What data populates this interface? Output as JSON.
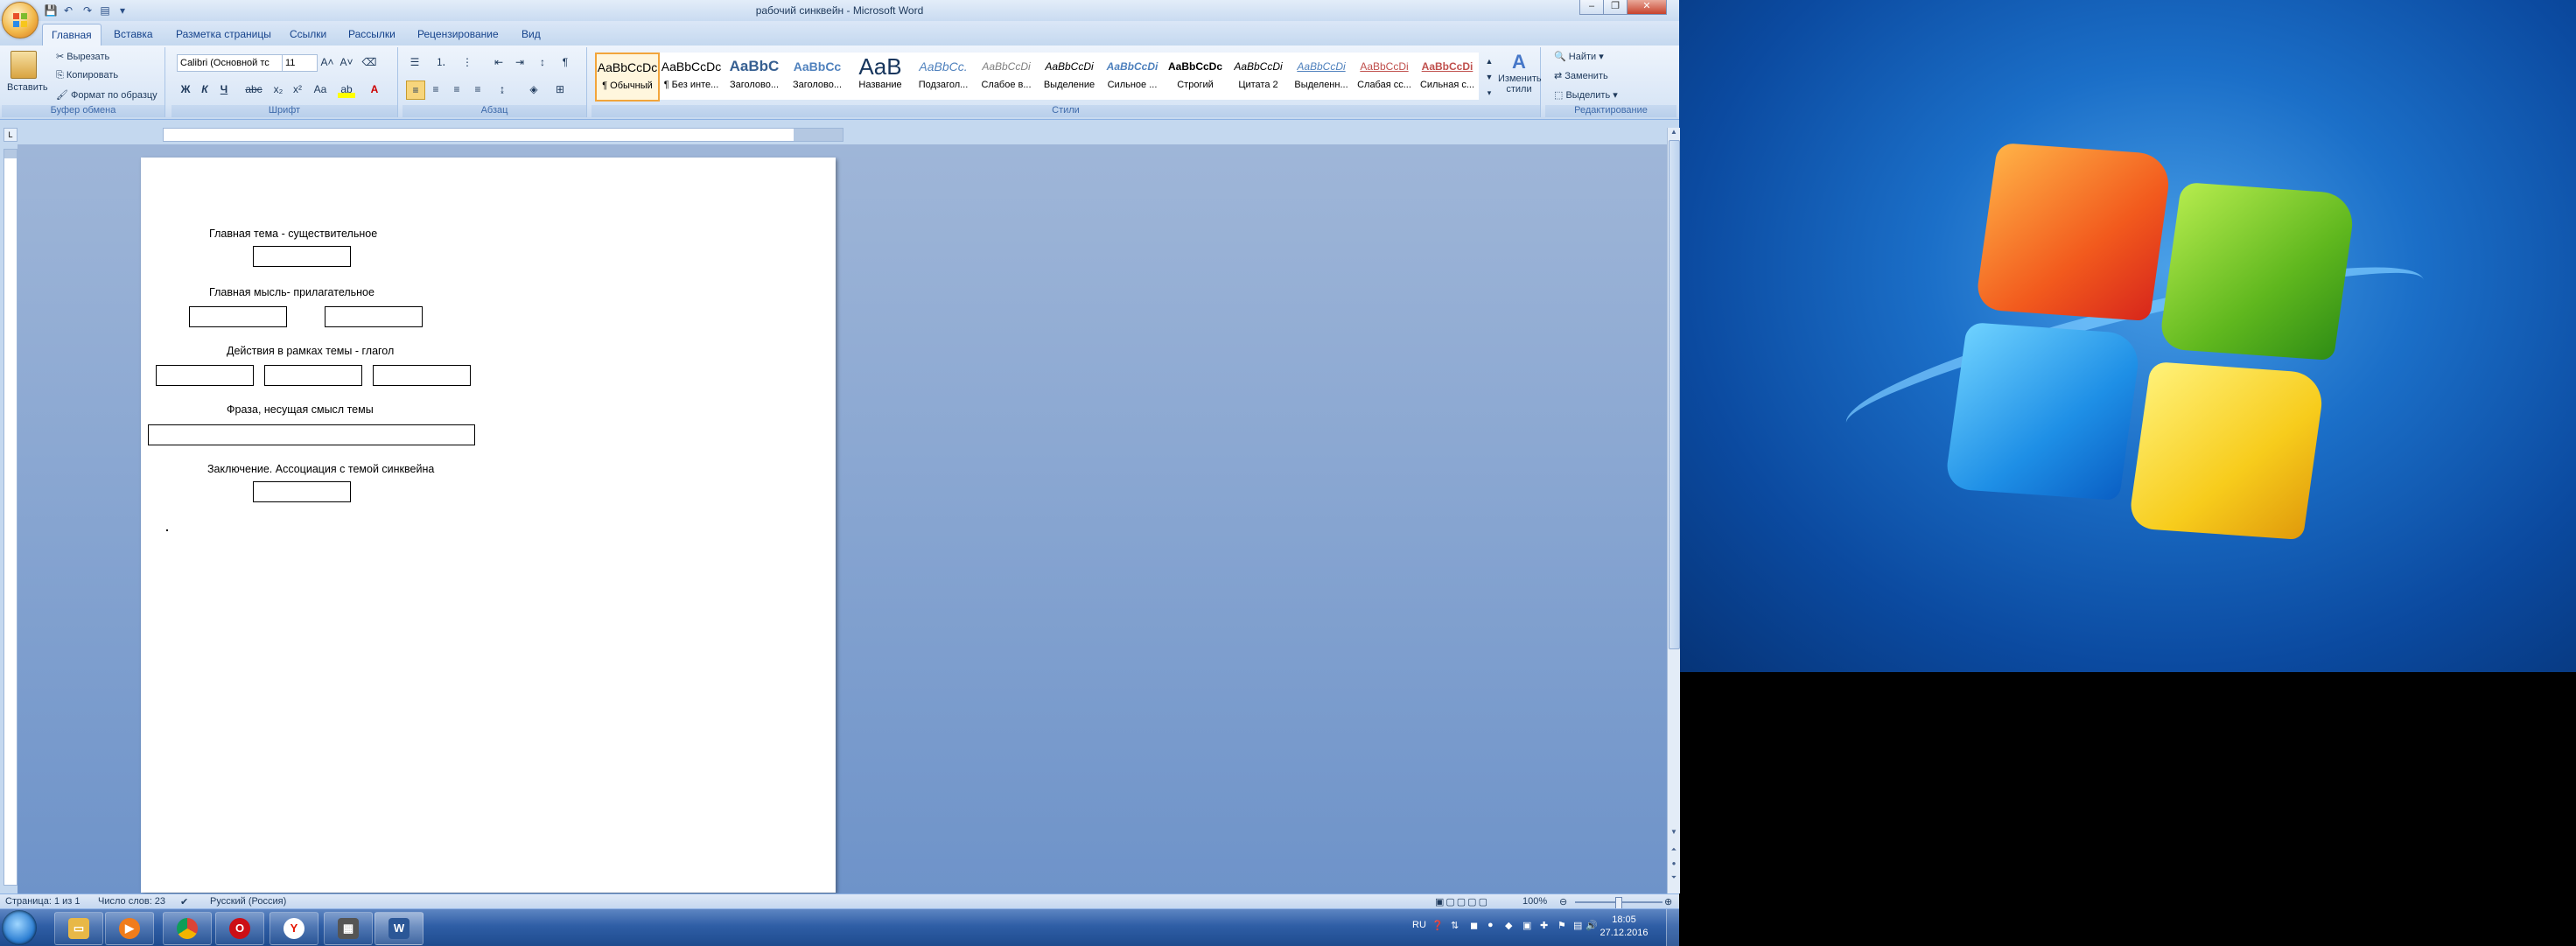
{
  "window": {
    "title": "рабочий синквейн - Microsoft Word"
  },
  "tabs": [
    "Главная",
    "Вставка",
    "Разметка страницы",
    "Ссылки",
    "Рассылки",
    "Рецензирование",
    "Вид"
  ],
  "active_tab": "Главная",
  "clipboard": {
    "paste": "Вставить",
    "cut": "Вырезать",
    "copy": "Копировать",
    "format_painter": "Формат по образцу",
    "group_label": "Буфер обмена"
  },
  "font": {
    "name": "Calibri (Основной тс",
    "size": "11",
    "group_label": "Шрифт",
    "bold": "Ж",
    "italic": "К",
    "underline": "Ч"
  },
  "paragraph": {
    "group_label": "Абзац"
  },
  "styles": {
    "group_label": "Стили",
    "items": [
      {
        "sample": "AaBbCcDc",
        "name": "¶ Обычный"
      },
      {
        "sample": "AaBbCcDc",
        "name": "¶ Без инте..."
      },
      {
        "sample": "AaBbC",
        "name": "Заголово..."
      },
      {
        "sample": "AaBbCc",
        "name": "Заголово..."
      },
      {
        "sample": "AaB",
        "name": "Название"
      },
      {
        "sample": "AaBbCc.",
        "name": "Подзагол..."
      },
      {
        "sample": "AaBbCcDi",
        "name": "Слабое в..."
      },
      {
        "sample": "AaBbCcDi",
        "name": "Выделение"
      },
      {
        "sample": "AaBbCcDi",
        "name": "Сильное ..."
      },
      {
        "sample": "AaBbCcDc",
        "name": "Строгий"
      },
      {
        "sample": "AaBbCcDi",
        "name": "Цитата 2"
      },
      {
        "sample": "AaBbCcDi",
        "name": "Выделенн..."
      },
      {
        "sample": "AaBbCcDi",
        "name": "Слабая сс..."
      },
      {
        "sample": "AaBbCcDi",
        "name": "Сильная с..."
      }
    ],
    "change_styles": "Изменить стили"
  },
  "editing": {
    "group_label": "Редактирование",
    "find": "Найти",
    "replace": "Заменить",
    "select": "Выделить"
  },
  "document": {
    "lines": [
      "Главная тема - существительное",
      "Главная мысль-  прилагательное",
      "Действия в рамках темы - глагол",
      "Фраза, несущая смысл темы",
      "Заключение. Ассоциация с темой синквейна"
    ]
  },
  "status": {
    "page": "Страница: 1 из 1",
    "words": "Число слов: 23",
    "language": "Русский (Россия)",
    "zoom": "100%"
  },
  "tray": {
    "lang": "RU",
    "time": "18:05",
    "date": "27.12.2016"
  },
  "colors": {
    "ribbon_text": "#1e395b",
    "accent": "#15428b",
    "taskbar": "#2f5ea6"
  }
}
